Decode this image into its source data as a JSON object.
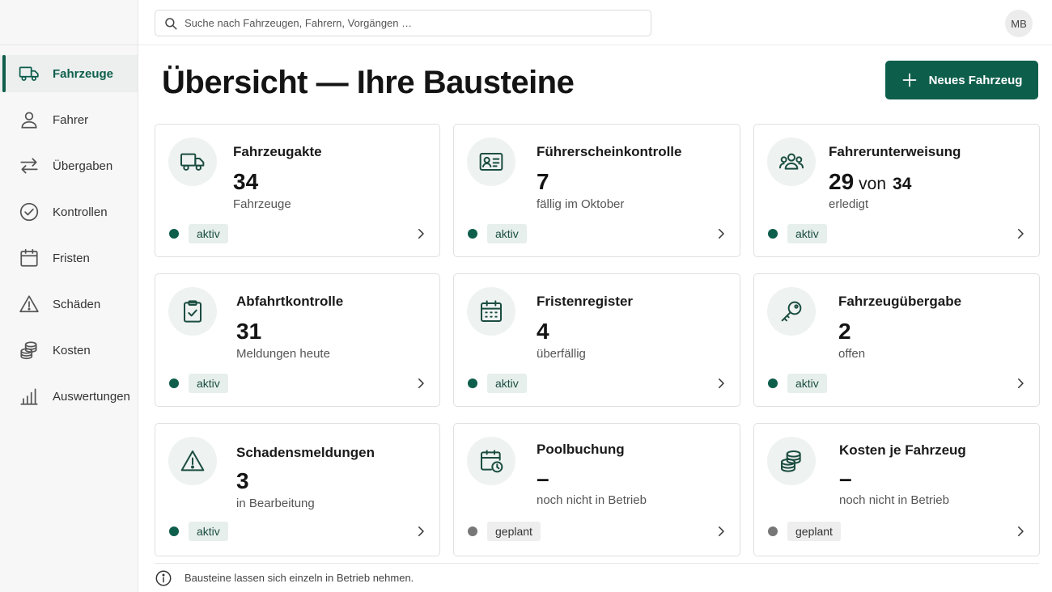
{
  "sidebar": {
    "items": [
      {
        "label": "Fahrzeuge",
        "icon": "truck-icon",
        "active": true
      },
      {
        "label": "Fahrer",
        "icon": "user-icon"
      },
      {
        "label": "Übergaben",
        "icon": "swap-arrows-icon"
      },
      {
        "label": "Kontrollen",
        "icon": "check-circle-icon"
      },
      {
        "label": "Fristen",
        "icon": "calendar-icon"
      },
      {
        "label": "Schäden",
        "icon": "warning-icon"
      },
      {
        "label": "Kosten",
        "icon": "coins-icon"
      },
      {
        "label": "Auswertungen",
        "icon": "bar-chart-icon"
      }
    ]
  },
  "topbar": {
    "search_placeholder": "Suche nach Fahrzeugen, Fahrern, Vorgängen …",
    "avatar_initials": "MB"
  },
  "main": {
    "title": "Übersicht — Ihre Bausteine",
    "primary_button": "Neues Fahrzeug"
  },
  "cards": [
    {
      "title": "Fahrzeugakte",
      "value": "34",
      "desc": "Fahrzeuge",
      "status": "aktiv",
      "icon": "truck-icon"
    },
    {
      "title": "Führerscheinkontrolle",
      "value": "7",
      "desc": "fällig im Oktober",
      "status": "aktiv",
      "icon": "id-card-icon"
    },
    {
      "title": "Fahrerunterweisung",
      "value": "29",
      "value_of": "von",
      "value_total": "34",
      "desc": "erledigt",
      "status": "aktiv",
      "icon": "group-icon"
    },
    {
      "title": "Abfahrtkontrolle",
      "value": "31",
      "desc": "Meldungen heute",
      "status": "aktiv",
      "icon": "clipboard-check-icon"
    },
    {
      "title": "Fristenregister",
      "value": "4",
      "desc": "überfällig",
      "status": "aktiv",
      "icon": "calendar-icon"
    },
    {
      "title": "Fahrzeugübergabe",
      "value": "2",
      "desc": "offen",
      "status": "aktiv",
      "icon": "key-icon"
    },
    {
      "title": "Schadensmeldungen",
      "value": "3",
      "desc": "in Bearbeitung",
      "status": "aktiv",
      "icon": "warning-icon"
    },
    {
      "title": "Poolbuchung",
      "value": "–",
      "desc": "noch nicht in Betrieb",
      "status": "geplant",
      "icon": "calendar-clock-icon"
    },
    {
      "title": "Kosten je Fahrzeug",
      "value": "–",
      "desc": "noch nicht in Betrieb",
      "status": "geplant",
      "icon": "coins-icon"
    }
  ],
  "footer": {
    "text": "Bausteine lassen sich einzeln in Betrieb nehmen.",
    "icon": "info-icon"
  },
  "colors": {
    "accent": "#0e5e4c",
    "badge_active_bg": "#e6efeb",
    "badge_planned_bg": "#eeeeee",
    "dot_planned": "#777777"
  }
}
